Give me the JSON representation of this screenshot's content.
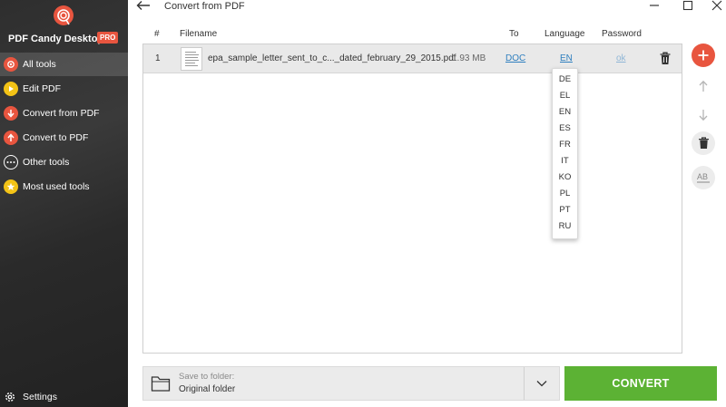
{
  "app": {
    "name": "PDF Candy Desktop",
    "badge": "PRO",
    "accent_color": "#e8553f",
    "convert_color": "#5cb234"
  },
  "sidebar": {
    "items": [
      {
        "label": "All tools",
        "icon": "all-tools-icon",
        "active": true
      },
      {
        "label": "Edit PDF",
        "icon": "edit-pdf-icon",
        "active": false
      },
      {
        "label": "Convert from PDF",
        "icon": "arrow-down-icon",
        "active": false
      },
      {
        "label": "Convert to PDF",
        "icon": "arrow-up-icon",
        "active": false
      },
      {
        "label": "Other tools",
        "icon": "dots-icon",
        "active": false
      },
      {
        "label": "Most used tools",
        "icon": "star-icon",
        "active": false
      }
    ],
    "settings_label": "Settings"
  },
  "header": {
    "title": "Convert from PDF"
  },
  "table": {
    "columns": {
      "index": "#",
      "filename": "Filename",
      "to": "To",
      "language": "Language",
      "password": "Password"
    },
    "rows": [
      {
        "index": "1",
        "filename": "epa_sample_letter_sent_to_c..._dated_february_29_2015.pdf",
        "size": "1.93 MB",
        "to": "DOC",
        "language": "EN",
        "password": "ok"
      }
    ]
  },
  "language_menu": {
    "options": [
      "DE",
      "EL",
      "EN",
      "ES",
      "FR",
      "IT",
      "KO",
      "PL",
      "PT",
      "RU"
    ]
  },
  "bottom": {
    "save_label": "Save to folder:",
    "save_value": "Original folder",
    "convert_label": "CONVERT"
  }
}
